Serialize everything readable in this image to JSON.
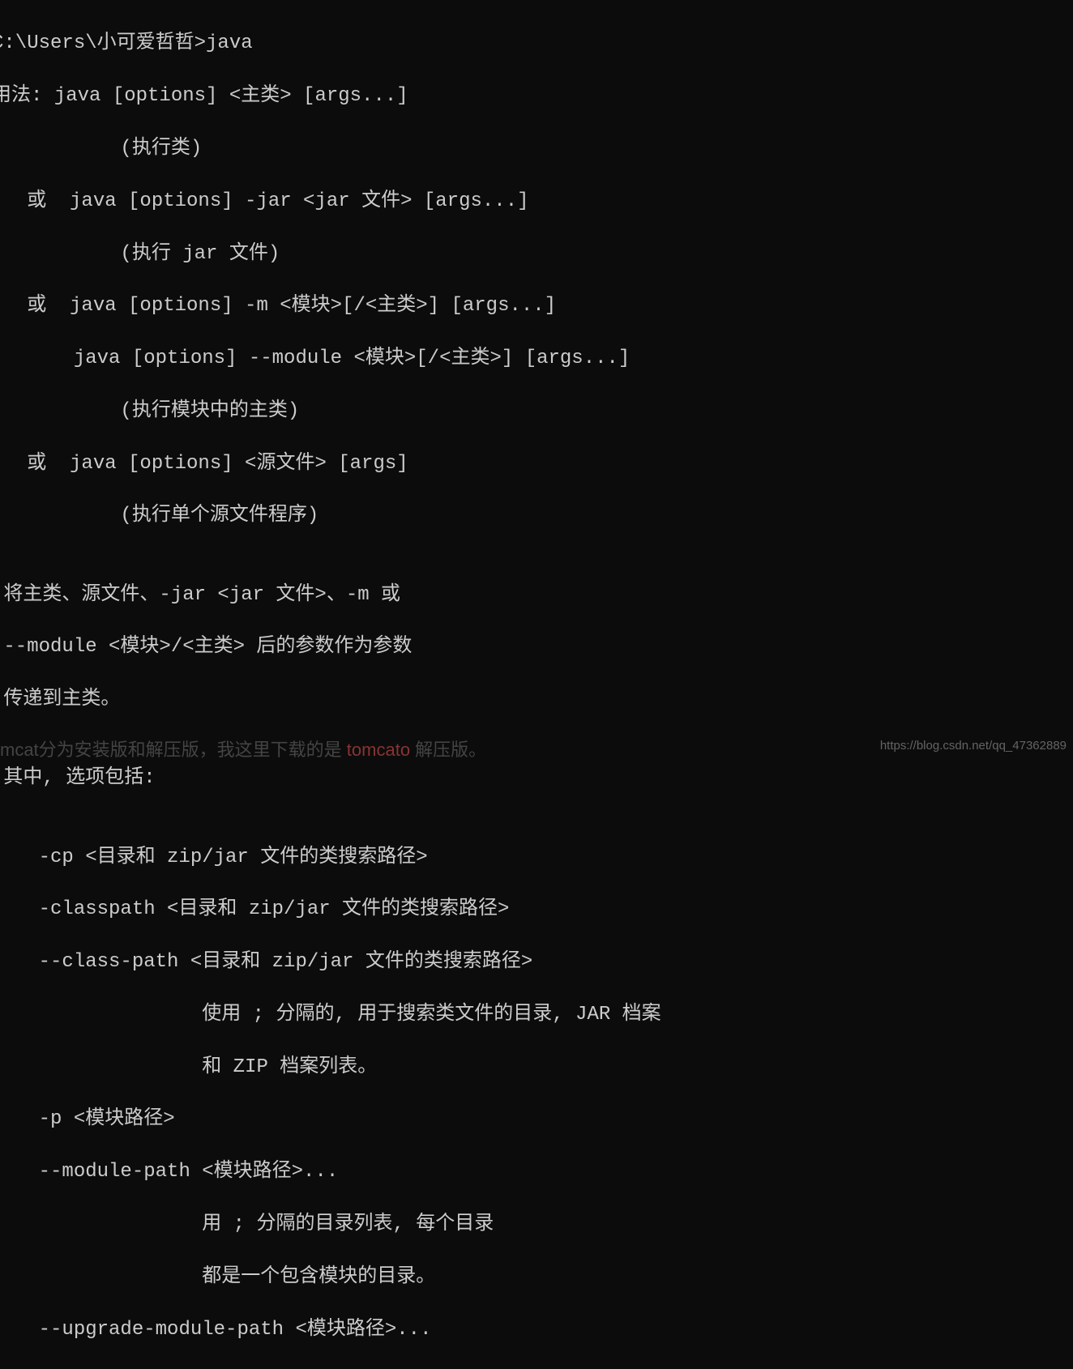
{
  "terminal": {
    "lines": [
      "C:\\Users\\小可爱哲哲>java",
      "用法: java [options] <主类> [args...]",
      "           (执行类)",
      "   或  java [options] -jar <jar 文件> [args...]",
      "           (执行 jar 文件)",
      "   或  java [options] -m <模块>[/<主类>] [args...]",
      "       java [options] --module <模块>[/<主类>] [args...]",
      "           (执行模块中的主类)",
      "   或  java [options] <源文件> [args]",
      "           (执行单个源文件程序)",
      "",
      " 将主类、源文件、-jar <jar 文件>、-m 或",
      " --module <模块>/<主类> 后的参数作为参数",
      " 传递到主类。",
      "",
      " 其中, 选项包括:",
      "",
      "    -cp <目录和 zip/jar 文件的类搜索路径>",
      "    -classpath <目录和 zip/jar 文件的类搜索路径>",
      "    --class-path <目录和 zip/jar 文件的类搜索路径>",
      "                  使用 ; 分隔的, 用于搜索类文件的目录, JAR 档案",
      "                  和 ZIP 档案列表。",
      "    -p <模块路径>",
      "    --module-path <模块路径>...",
      "                  用 ; 分隔的目录列表, 每个目录",
      "                  都是一个包含模块的目录。",
      "    --upgrade-module-path <模块路径>..."
    ]
  },
  "partial": {
    "prefix": "mcat分为安装版和解压版，我这里下载的是 ",
    "red": "tomcato",
    "suffix": " 解压版。"
  },
  "watermark": "https://blog.csdn.net/qq_47362889"
}
